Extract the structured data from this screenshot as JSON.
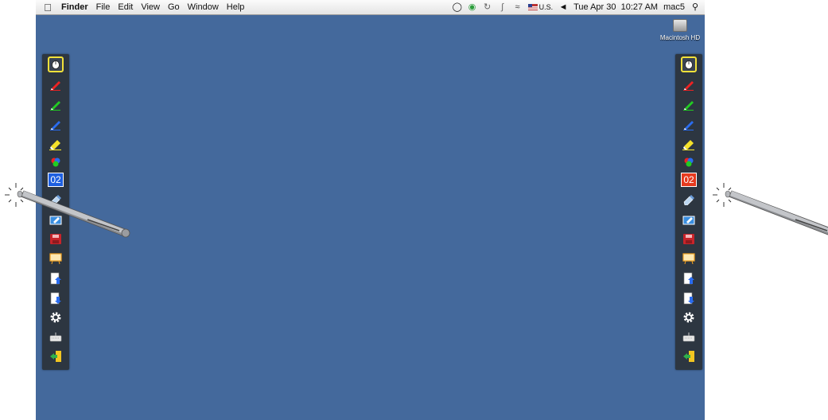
{
  "menubar": {
    "apple_icon": "apple-icon",
    "app_name": "Finder",
    "menus": [
      "File",
      "Edit",
      "View",
      "Go",
      "Window",
      "Help"
    ],
    "status_icons": [
      "whiteboard-mouse-icon",
      "green-sync-icon",
      "time-machine-icon",
      "bluetooth-icon",
      "wifi-icon",
      "us-flag-icon",
      "volume-icon"
    ],
    "input_source": "U.S.",
    "clock": "Tue Apr 30  10:27 AM",
    "user": "mac5",
    "spotlight_icon": "magnifier-icon"
  },
  "desktop": {
    "background_color": "#44699c",
    "hd_label": "Macintosh HD",
    "hd_icon": "hard-drive-icon"
  },
  "toolbar_left": {
    "page_number": "02",
    "page_color": "#1e5fe0",
    "tools": [
      "mouse-pointer-icon",
      "red-pen-icon",
      "green-pen-icon",
      "blue-pen-icon",
      "yellow-highlighter-icon",
      "color-palette-icon",
      "page-counter",
      "eraser-icon",
      "screen-capture-icon",
      "save-icon",
      "whiteboard-icon",
      "page-up-icon",
      "page-down-icon",
      "settings-icon",
      "keyboard-icon",
      "exit-icon"
    ]
  },
  "toolbar_right": {
    "page_number": "02",
    "page_color": "#e63a1e",
    "tools": [
      "mouse-pointer-icon",
      "red-pen-icon",
      "green-pen-icon",
      "blue-pen-icon",
      "yellow-highlighter-icon",
      "color-palette-icon",
      "page-counter",
      "eraser-icon",
      "screen-capture-icon",
      "save-icon",
      "whiteboard-icon",
      "page-up-icon",
      "page-down-icon",
      "settings-icon",
      "keyboard-icon",
      "exit-icon"
    ]
  }
}
